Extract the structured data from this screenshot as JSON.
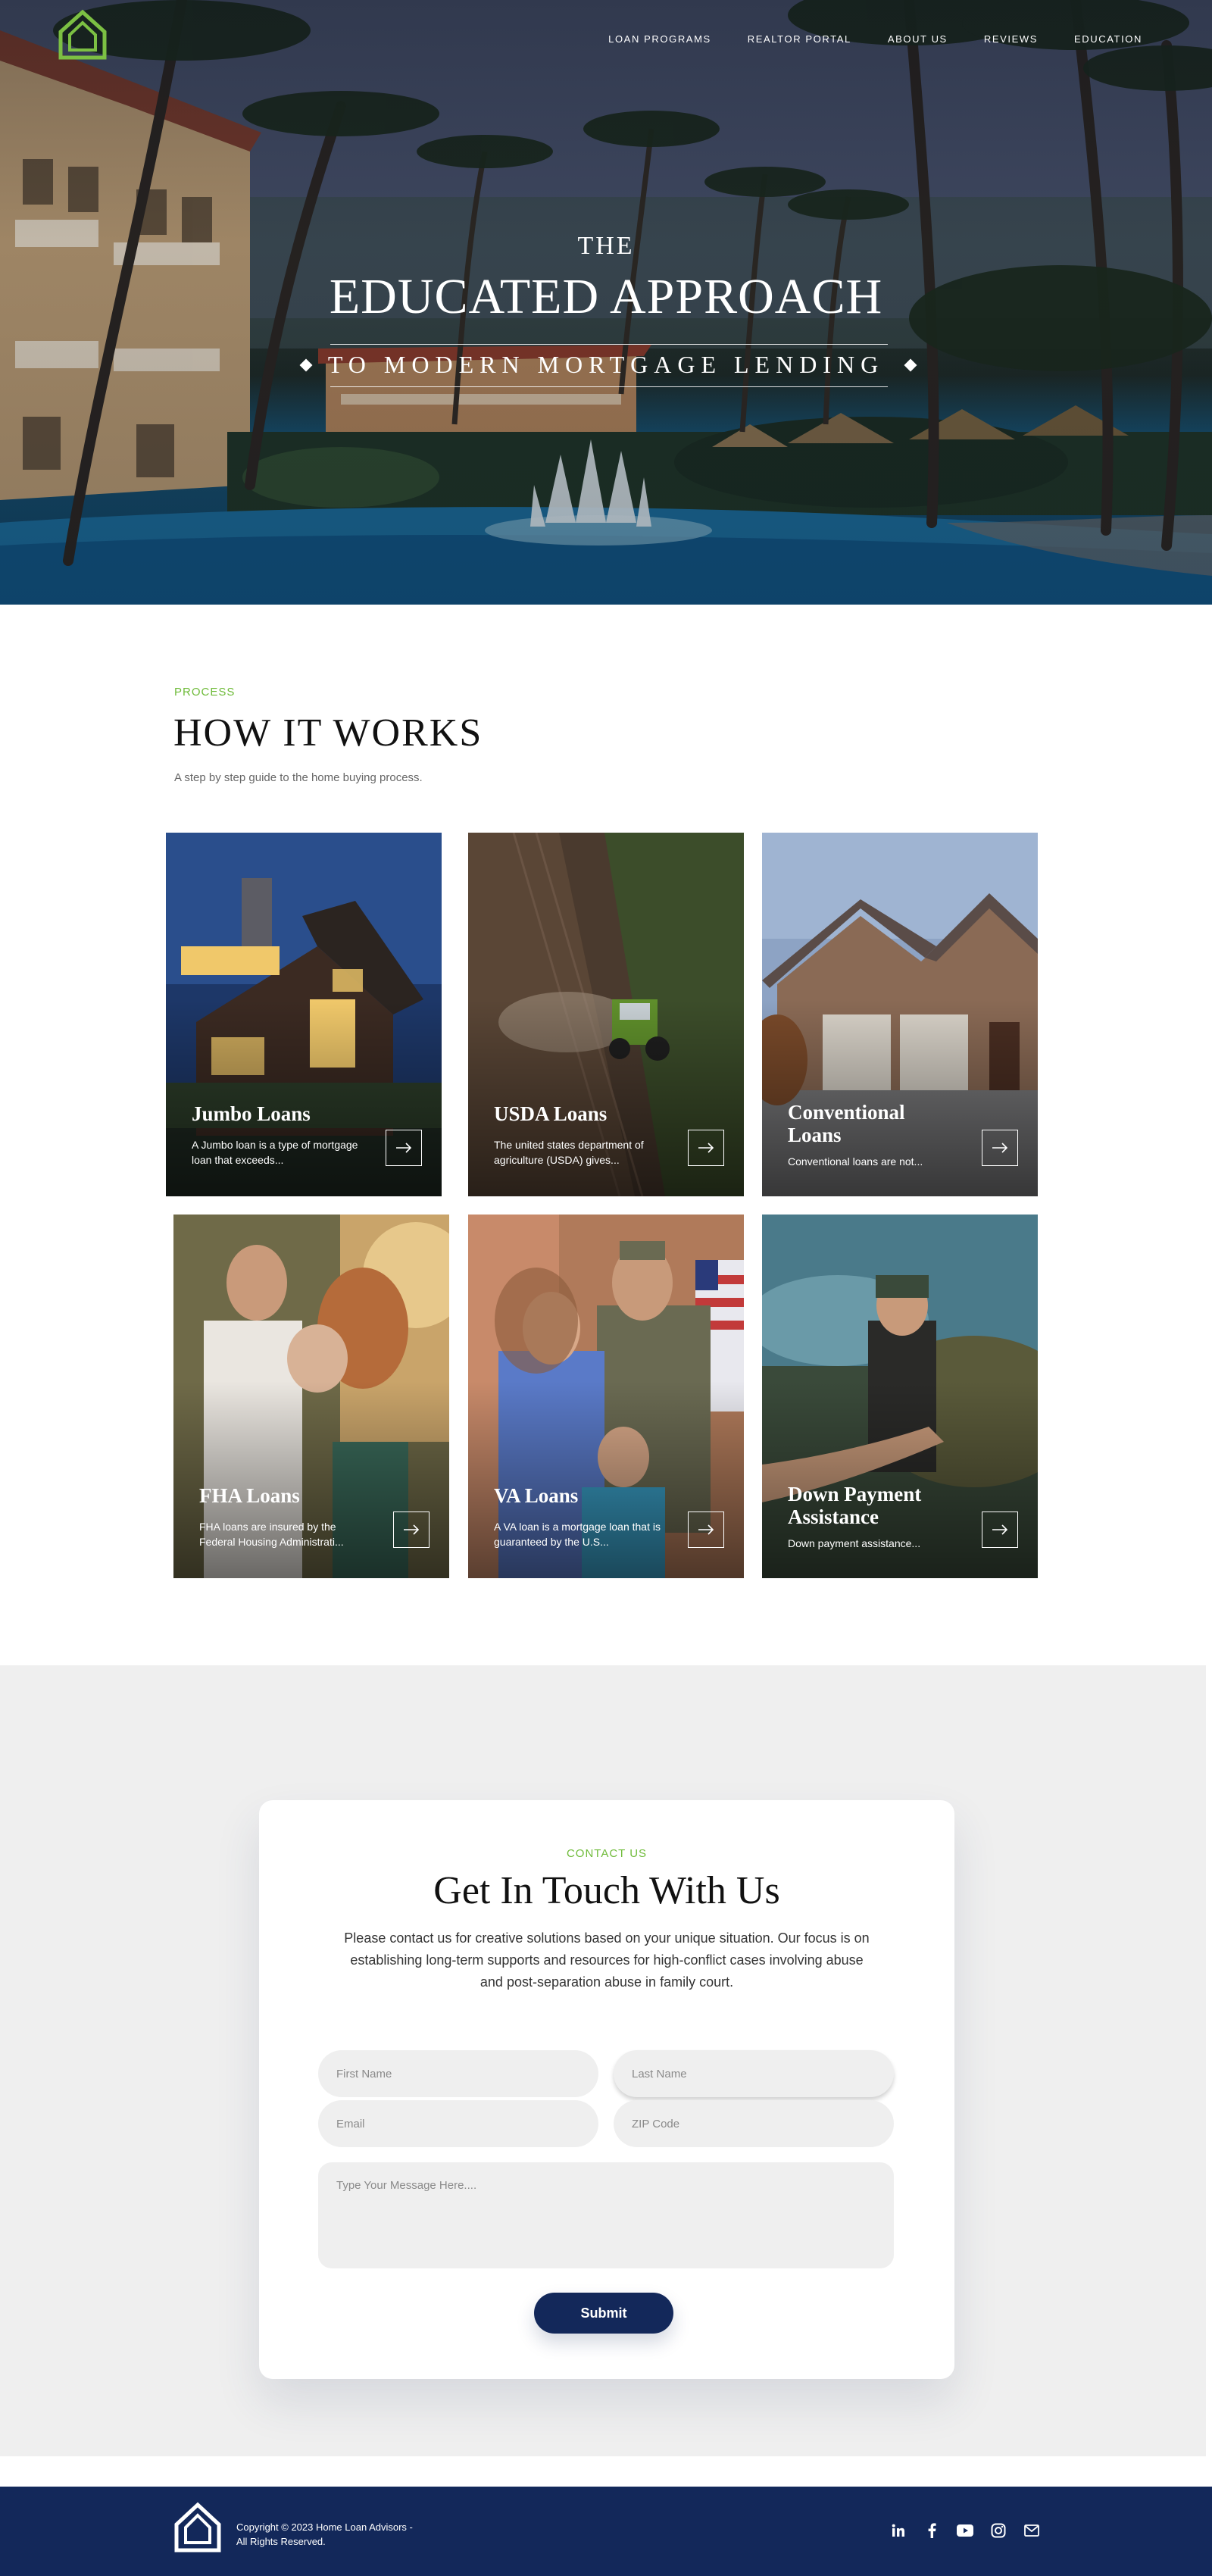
{
  "nav": {
    "items": [
      "LOAN PROGRAMS",
      "REALTOR PORTAL",
      "ABOUT US",
      "REVIEWS",
      "EDUCATION"
    ]
  },
  "hero": {
    "pre_title": "THE",
    "title": "EDUCATED APPROACH",
    "subtitle": "TO MODERN MORTGAGE LENDING"
  },
  "process": {
    "eyebrow": "PROCESS",
    "title": "HOW IT WORKS",
    "description": "A step by step guide to the home buying process.",
    "cards": [
      {
        "title": "Jumbo Loans",
        "description": "A Jumbo loan is a type of mortgage loan that exceeds..."
      },
      {
        "title": "USDA Loans",
        "description": "The united states department of agriculture (USDA) gives..."
      },
      {
        "title": "Conventional Loans",
        "description": "Conventional loans are not..."
      },
      {
        "title": "FHA Loans",
        "description": "FHA loans are insured by the Federal Housing Administrati..."
      },
      {
        "title": "VA Loans",
        "description": "A VA loan is a mortgage loan that is guaranteed by the U.S..."
      },
      {
        "title": "Down Payment Assistance",
        "description": "Down payment assistance..."
      }
    ]
  },
  "contact": {
    "eyebrow": "CONTACT US",
    "title": "Get In Touch With Us",
    "description": "Please contact us for creative solutions based on your unique situation. Our focus is on establishing long-term supports and resources for high-conflict cases involving abuse and post-separation abuse in family court.",
    "fields": {
      "first_name": "First Name",
      "last_name": "Last Name",
      "email": "Email",
      "zip": "ZIP Code",
      "message": "Type Your Message Here...."
    },
    "submit_label": "Submit"
  },
  "footer": {
    "copyright_line1": "Copyright © 2023 Home Loan Advisors -",
    "copyright_line2": "All Rights Reserved.",
    "social_icons": [
      "linkedin-icon",
      "facebook-icon",
      "youtube-icon",
      "instagram-icon",
      "email-icon"
    ]
  },
  "colors": {
    "accent_green": "#6fbb3a",
    "navy": "#13285a",
    "section_gray": "#efefef"
  }
}
